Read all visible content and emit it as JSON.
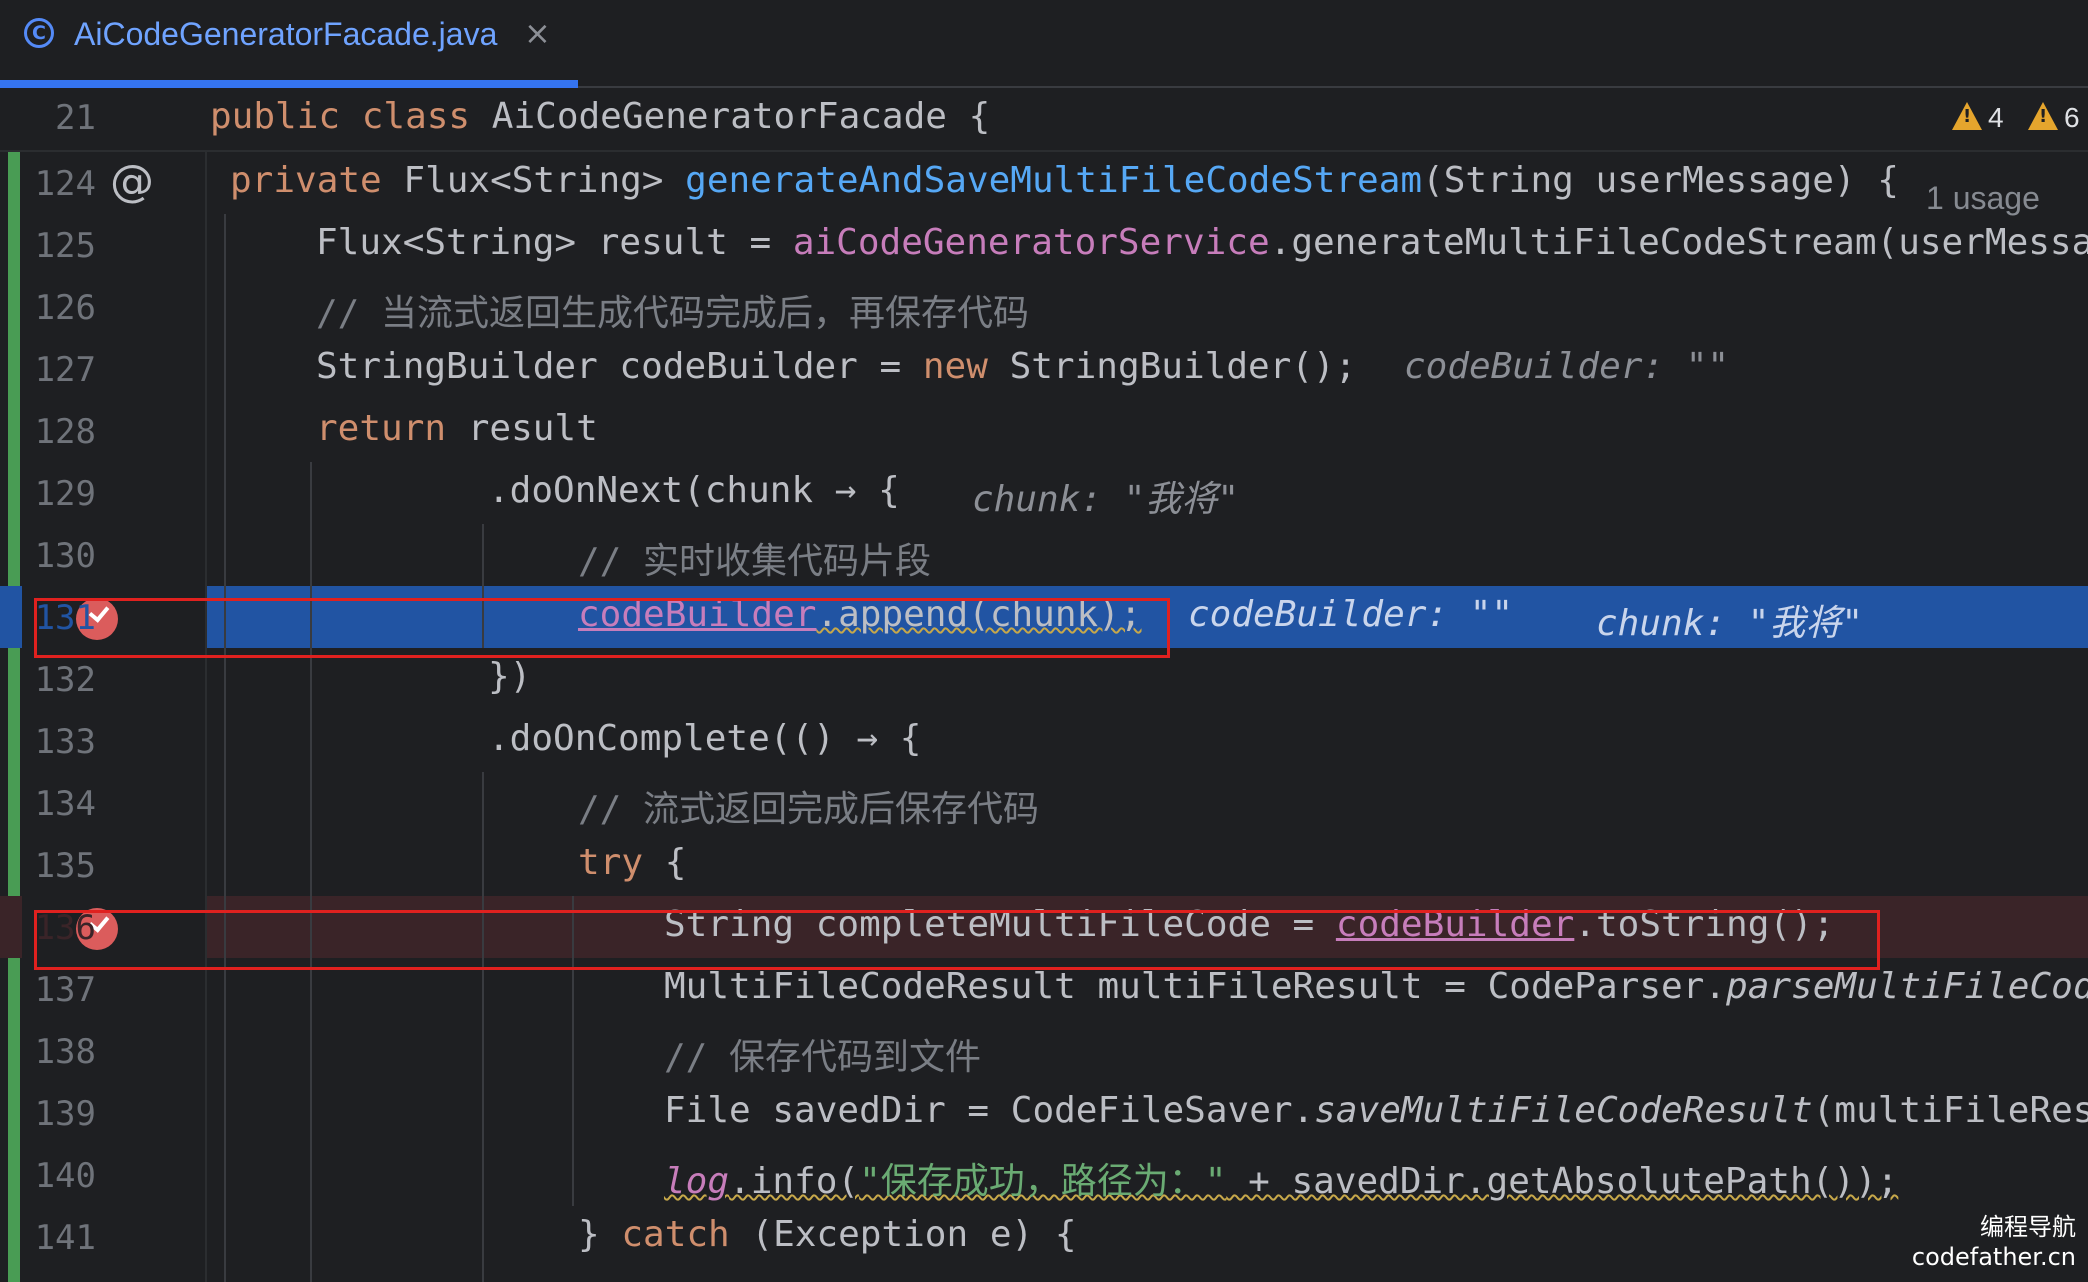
{
  "tab": {
    "icon": "C",
    "filename": "AiCodeGeneratorFacade.java",
    "close": "×"
  },
  "sticky": {
    "line": "21",
    "kw1": "public",
    "kw2": "class",
    "name": "AiCodeGeneratorFacade {"
  },
  "warnings": [
    {
      "count": "4"
    },
    {
      "count": "6"
    }
  ],
  "lines": {
    "l124": {
      "n": "124",
      "kw": "private",
      "t1": " Flux<String> ",
      "fn": "generateAndSaveMultiFileCodeStream",
      "t2": "(String userMessage) {",
      "usage": "1 usage"
    },
    "l125": {
      "n": "125",
      "t1": "Flux<String> result = ",
      "fld": "aiCodeGeneratorService",
      "t2": ".generateMultiFileCodeStream(userMessa"
    },
    "l126": {
      "n": "126",
      "c": "// 当流式返回生成代码完成后，再保存代码"
    },
    "l127": {
      "n": "127",
      "t1": "StringBuilder codeBuilder = ",
      "kw": "new",
      "t2": " StringBuilder();",
      "hint": "codeBuilder: \"\""
    },
    "l128": {
      "n": "128",
      "kw": "return",
      "t1": " result"
    },
    "l129": {
      "n": "129",
      "t1": ".doOnNext(chunk → {",
      "hint": "chunk: \"我将\""
    },
    "l130": {
      "n": "130",
      "c": "// 实时收集代码片段"
    },
    "l131": {
      "n": "131",
      "fld": "codeBuilder",
      "t1": ".append(chunk);",
      "hint1": "codeBuilder: \"\"",
      "hint2": "chunk: \"我将\""
    },
    "l132": {
      "n": "132",
      "t1": "})"
    },
    "l133": {
      "n": "133",
      "t1": ".doOnComplete(() → {"
    },
    "l134": {
      "n": "134",
      "c": "// 流式返回完成后保存代码"
    },
    "l135": {
      "n": "135",
      "kw": "try",
      "t1": " {"
    },
    "l136": {
      "n": "136",
      "t1": "String completeMultiFileCode = ",
      "fld": "codeBuilder",
      "t2": ".toString();"
    },
    "l137": {
      "n": "137",
      "t1": "MultiFileCodeResult multiFileResult = CodeParser.",
      "it": "parseMultiFileCod"
    },
    "l138": {
      "n": "138",
      "c": "// 保存代码到文件"
    },
    "l139": {
      "n": "139",
      "t1": "File savedDir = CodeFileSaver.",
      "it": "saveMultiFileCodeResult",
      "t2": "(multiFileRes"
    },
    "l140": {
      "n": "140",
      "fld": "log",
      "t1": ".info(",
      "str": "\"保存成功，路径为：\"",
      "t2": " + savedDir.getAbsolutePath());"
    },
    "l141": {
      "n": "141",
      "t1": "} ",
      "kw": "catch",
      "t2": " (Exception e) {"
    }
  },
  "watermark": {
    "line1": "编程导航",
    "line2": "codefather.cn"
  },
  "colors": {
    "keyword": "#cf8e6d",
    "method": "#56a8f5",
    "field": "#c77dbb",
    "string": "#6aab73",
    "comment": "#7a7e85",
    "execution_line": "#2154a3",
    "breakpoint": "#db5c5c",
    "highlight_box": "#e0211f"
  }
}
